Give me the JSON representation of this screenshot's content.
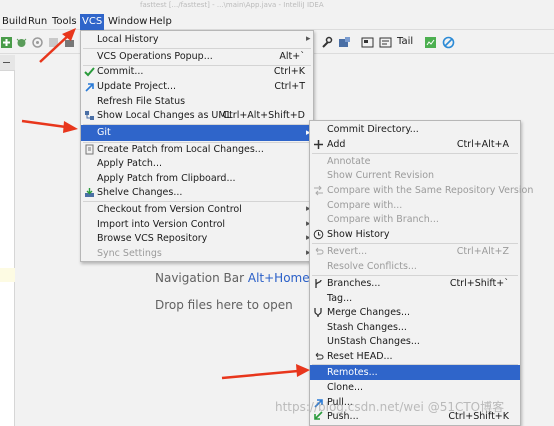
{
  "window": {
    "title": "fasttest [.../fasttest] - ...\\main\\App.java - IntelliJ IDEA"
  },
  "menubar": {
    "items": [
      "Build",
      "Run",
      "Tools",
      "VCS",
      "Window",
      "Help"
    ]
  },
  "toolbar": {
    "tail_label": "Tail"
  },
  "editor": {
    "navigation_text": "Navigation Bar ",
    "navigation_key": "Alt+Home",
    "drop_text": "Drop files here to open"
  },
  "vcs_menu": {
    "items": [
      {
        "label": "Local History",
        "shortcut": "",
        "submenu": true,
        "icon": ""
      },
      {
        "label": "VCS Operations Popup...",
        "shortcut": "Alt+`",
        "icon": ""
      },
      {
        "label": "Commit...",
        "shortcut": "Ctrl+K",
        "icon": "commit-icon"
      },
      {
        "label": "Update Project...",
        "shortcut": "Ctrl+T",
        "icon": "update-icon"
      },
      {
        "label": "Refresh File Status",
        "shortcut": "",
        "icon": ""
      },
      {
        "label": "Show Local Changes as UML",
        "shortcut": "Ctrl+Alt+Shift+D",
        "icon": "uml-icon"
      },
      {
        "label": "Git",
        "shortcut": "",
        "submenu": true,
        "selected": true,
        "icon": ""
      },
      {
        "label": "Create Patch from Local Changes...",
        "shortcut": "",
        "icon": "patch-icon"
      },
      {
        "label": "Apply Patch...",
        "shortcut": "",
        "icon": ""
      },
      {
        "label": "Apply Patch from Clipboard...",
        "shortcut": "",
        "icon": ""
      },
      {
        "label": "Shelve Changes...",
        "shortcut": "",
        "icon": "shelve-icon"
      },
      {
        "label": "Checkout from Version Control",
        "shortcut": "",
        "submenu": true,
        "icon": ""
      },
      {
        "label": "Import into Version Control",
        "shortcut": "",
        "submenu": true,
        "icon": ""
      },
      {
        "label": "Browse VCS Repository",
        "shortcut": "",
        "submenu": true,
        "icon": ""
      },
      {
        "label": "Sync Settings",
        "shortcut": "",
        "submenu": true,
        "disabled": true,
        "icon": ""
      }
    ]
  },
  "git_menu": {
    "items": [
      {
        "label": "Commit Directory...",
        "shortcut": "",
        "icon": ""
      },
      {
        "label": "Add",
        "shortcut": "Ctrl+Alt+A",
        "icon": "plus-icon"
      },
      {
        "label": "Annotate",
        "shortcut": "",
        "disabled": true,
        "icon": ""
      },
      {
        "label": "Show Current Revision",
        "shortcut": "",
        "disabled": true,
        "icon": ""
      },
      {
        "label": "Compare with the Same Repository Version",
        "shortcut": "",
        "disabled": true,
        "icon": "compare-icon"
      },
      {
        "label": "Compare with...",
        "shortcut": "",
        "disabled": true,
        "icon": ""
      },
      {
        "label": "Compare with Branch...",
        "shortcut": "",
        "disabled": true,
        "icon": ""
      },
      {
        "label": "Show History",
        "shortcut": "",
        "icon": "history-icon"
      },
      {
        "label": "Revert...",
        "shortcut": "Ctrl+Alt+Z",
        "disabled": true,
        "icon": "revert-icon"
      },
      {
        "label": "Resolve Conflicts...",
        "shortcut": "",
        "disabled": true,
        "icon": ""
      },
      {
        "label": "Branches...",
        "shortcut": "Ctrl+Shift+`",
        "icon": "branch-icon"
      },
      {
        "label": "Tag...",
        "shortcut": "",
        "icon": ""
      },
      {
        "label": "Merge Changes...",
        "shortcut": "",
        "icon": "merge-icon"
      },
      {
        "label": "Stash Changes...",
        "shortcut": "",
        "icon": ""
      },
      {
        "label": "UnStash Changes...",
        "shortcut": "",
        "icon": ""
      },
      {
        "label": "Reset HEAD...",
        "shortcut": "",
        "icon": "reset-icon"
      },
      {
        "label": "Remotes...",
        "shortcut": "",
        "selected": true,
        "icon": ""
      },
      {
        "label": "Clone...",
        "shortcut": "",
        "icon": ""
      },
      {
        "label": "Pull...",
        "shortcut": "",
        "icon": "pull-icon"
      },
      {
        "label": "Push...",
        "shortcut": "Ctrl+Shift+K",
        "icon": "push-icon"
      }
    ]
  },
  "watermark": "https://blog.csdn.net/wei @51CTO博客",
  "colors": {
    "accent": "#2f65ca",
    "arrow": "#e8361c",
    "link_key": "#2b60c8"
  }
}
